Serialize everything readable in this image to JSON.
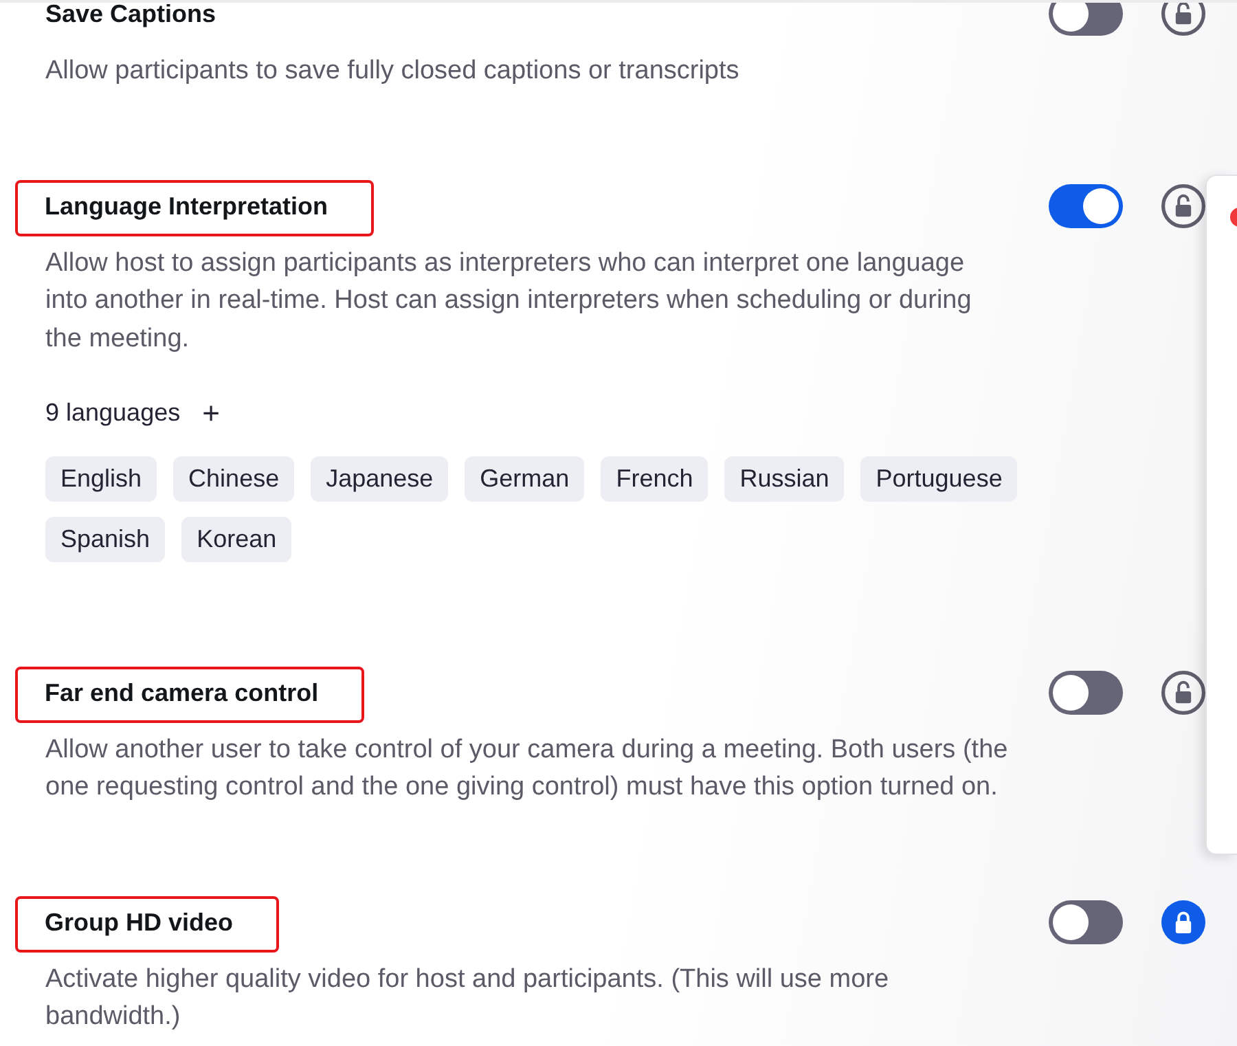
{
  "settings": [
    {
      "title": "Save Captions",
      "description": "Allow participants to save fully closed captions or transcripts",
      "enabled": false,
      "locked": false,
      "highlighted": false
    },
    {
      "title": "Language Interpretation",
      "description": "Allow host to assign participants as interpreters who can interpret one language into another in real-time. Host can assign interpreters when scheduling or during the meeting.",
      "enabled": true,
      "locked": false,
      "highlighted": true,
      "languages": {
        "count": "9 languages",
        "add_button": "+",
        "tags": [
          "English",
          "Chinese",
          "Japanese",
          "German",
          "French",
          "Russian",
          "Portuguese",
          "Spanish",
          "Korean"
        ]
      }
    },
    {
      "title": "Far end camera control",
      "description": "Allow another user to take control of your camera during a meeting. Both users (the one requesting control and the one giving control) must have this option turned on.",
      "enabled": false,
      "locked": false,
      "highlighted": true
    },
    {
      "title": "Group HD video",
      "description": "Activate higher quality video for host and participants. (This will use more bandwidth.)",
      "enabled": false,
      "locked": true,
      "highlighted": true
    }
  ]
}
